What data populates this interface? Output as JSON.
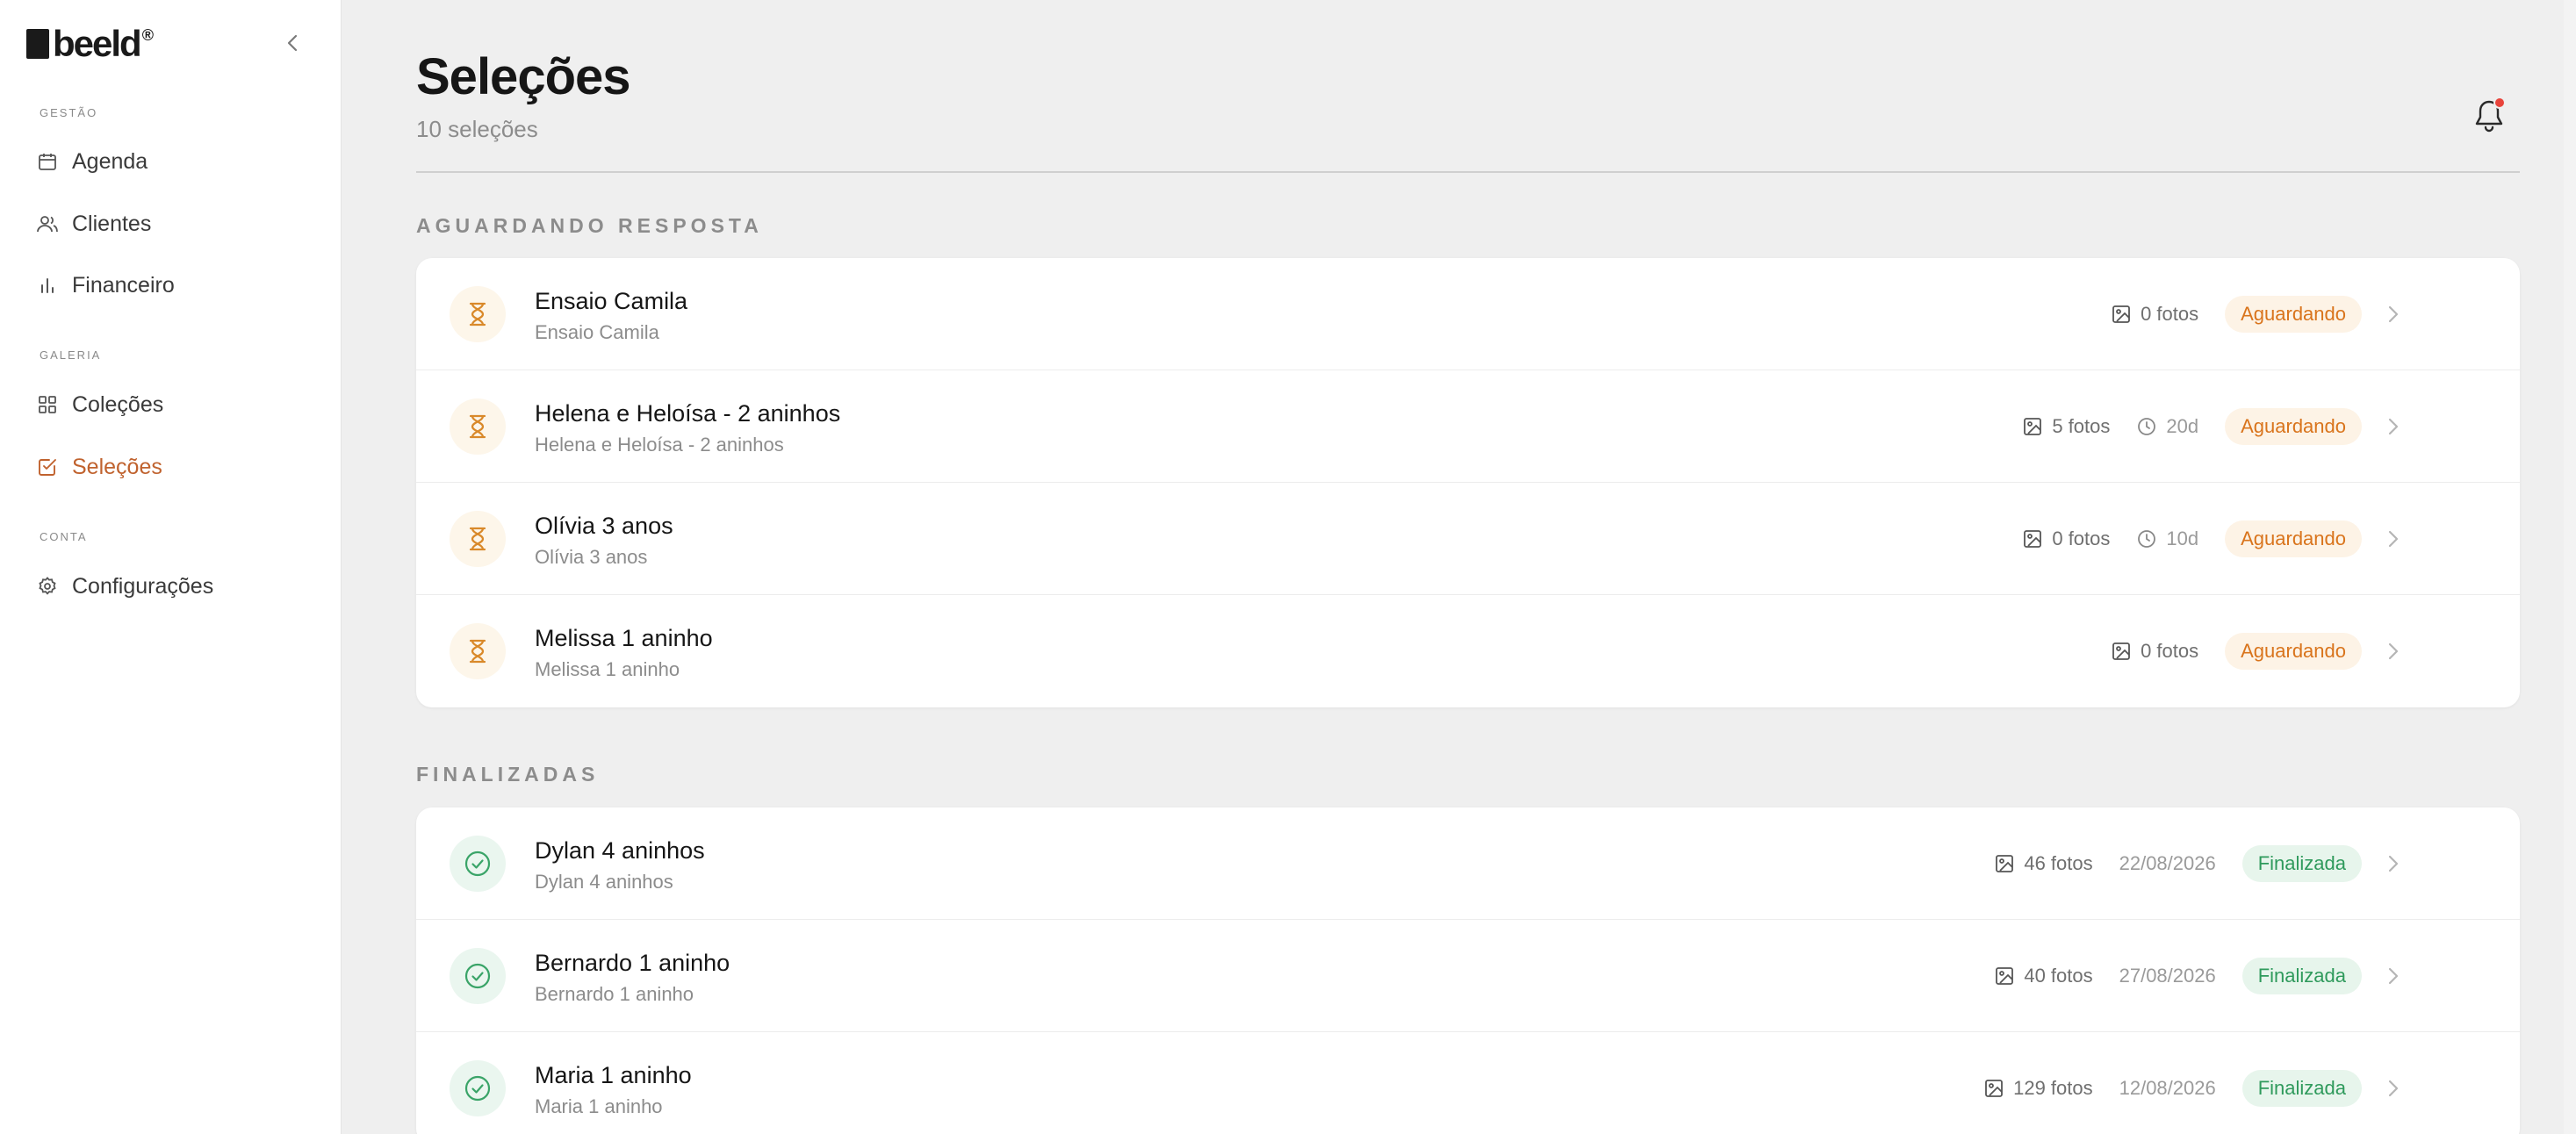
{
  "sidebar": {
    "logo_text": "beeld",
    "logo_reg": "®",
    "sections": {
      "gestao": "GESTÃO",
      "galeria": "GALERIA",
      "conta": "CONTA"
    },
    "items": [
      {
        "label": "Agenda",
        "icon": "calendar-icon"
      },
      {
        "label": "Clientes",
        "icon": "users-icon"
      },
      {
        "label": "Financeiro",
        "icon": "bar-chart-icon"
      },
      {
        "label": "Coleções",
        "icon": "grid-icon"
      },
      {
        "label": "Seleções",
        "icon": "checkbox-icon",
        "active": true
      },
      {
        "label": "Configurações",
        "icon": "gear-icon"
      }
    ]
  },
  "header": {
    "title": "Seleções",
    "subtitle": "10 seleções"
  },
  "sections": {
    "waiting": {
      "label": "AGUARDANDO RESPOSTA",
      "rows": [
        {
          "title": "Ensaio Camila",
          "subtitle": "Ensaio Camila",
          "photos": "0 fotos",
          "days": "",
          "status": "Aguardando"
        },
        {
          "title": "Helena e Heloísa - 2 aninhos",
          "subtitle": "Helena e Heloísa - 2 aninhos",
          "photos": "5 fotos",
          "days": "20d",
          "status": "Aguardando"
        },
        {
          "title": "Olívia 3 anos",
          "subtitle": "Olívia 3 anos",
          "photos": "0 fotos",
          "days": "10d",
          "status": "Aguardando"
        },
        {
          "title": "Melissa 1 aninho",
          "subtitle": "Melissa 1 aninho",
          "photos": "0 fotos",
          "days": "",
          "status": "Aguardando"
        }
      ]
    },
    "done": {
      "label": "FINALIZADAS",
      "rows": [
        {
          "title": "Dylan 4 aninhos",
          "subtitle": "Dylan 4 aninhos",
          "photos": "46 fotos",
          "date": "22/08/2026",
          "status": "Finalizada"
        },
        {
          "title": "Bernardo 1 aninho",
          "subtitle": "Bernardo 1 aninho",
          "photos": "40 fotos",
          "date": "27/08/2026",
          "status": "Finalizada"
        },
        {
          "title": "Maria 1 aninho",
          "subtitle": "Maria 1 aninho",
          "photos": "129 fotos",
          "date": "12/08/2026",
          "status": "Finalizada"
        }
      ]
    }
  },
  "colors": {
    "accent": "#c0622e",
    "waiting": "#d9741c",
    "done": "#2f9a5c",
    "notification": "#e8433a"
  }
}
